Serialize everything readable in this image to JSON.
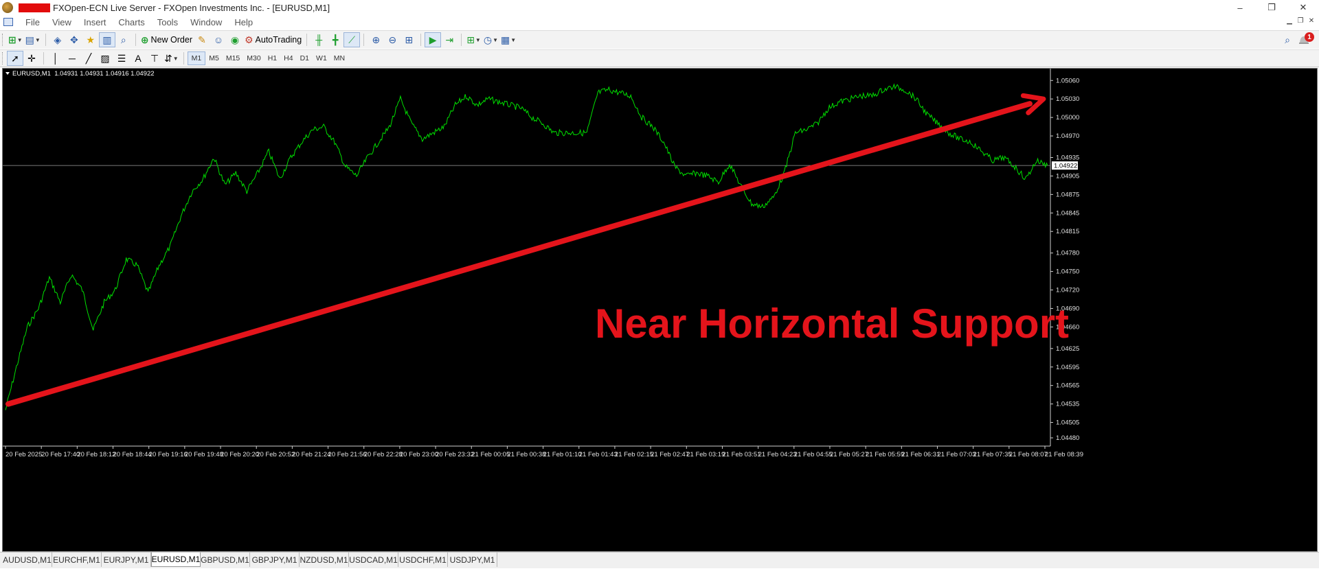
{
  "window": {
    "title": "FXOpen-ECN Live Server - FXOpen Investments Inc. - [EURUSD,M1]",
    "controls": [
      "–",
      "❐",
      "✕"
    ]
  },
  "menu": [
    "File",
    "View",
    "Insert",
    "Charts",
    "Tools",
    "Window",
    "Help"
  ],
  "toolbar": {
    "new_order_label": "New Order",
    "autotrading_label": "AutoTrading",
    "timeframes": [
      "M1",
      "M5",
      "M15",
      "M30",
      "H1",
      "H4",
      "D1",
      "W1",
      "MN"
    ],
    "active_timeframe": "M1",
    "notification_count": "1"
  },
  "chart": {
    "header": "EURUSD,M1  1.04931 1.04931 1.04916 1.04922",
    "current_price": "1.04922",
    "annotation": "Near Horizontal Support",
    "colors": {
      "background": "#000000",
      "line": "#00e000",
      "annotation": "#e4141b",
      "price_line": "#a0a0a0"
    }
  },
  "chart_data": {
    "type": "line",
    "symbol": "EURUSD",
    "timeframe": "M1",
    "ylim": [
      1.0448,
      1.05077
    ],
    "y_ticks": [
      "1.05060",
      "1.05030",
      "1.05000",
      "1.04970",
      "1.04935",
      "1.04905",
      "1.04875",
      "1.04845",
      "1.04815",
      "1.04780",
      "1.04750",
      "1.04720",
      "1.04690",
      "1.04660",
      "1.04625",
      "1.04595",
      "1.04565",
      "1.04535",
      "1.04505",
      "1.04480"
    ],
    "x_ticks": [
      "20 Feb 2025",
      "20 Feb 17:40",
      "20 Feb 18:12",
      "20 Feb 18:44",
      "20 Feb 19:16",
      "20 Feb 19:48",
      "20 Feb 20:20",
      "20 Feb 20:52",
      "20 Feb 21:24",
      "20 Feb 21:56",
      "20 Feb 22:28",
      "20 Feb 23:00",
      "20 Feb 23:32",
      "21 Feb 00:05",
      "21 Feb 00:38",
      "21 Feb 01:10",
      "21 Feb 01:43",
      "21 Feb 02:15",
      "21 Feb 02:47",
      "21 Feb 03:19",
      "21 Feb 03:51",
      "21 Feb 04:23",
      "21 Feb 04:55",
      "21 Feb 05:27",
      "21 Feb 05:59",
      "21 Feb 06:31",
      "21 Feb 07:03",
      "21 Feb 07:35",
      "21 Feb 08:07",
      "21 Feb 08:39"
    ],
    "series": [
      {
        "values": [
          1.04525,
          1.04595,
          1.0466,
          1.0469,
          1.0474,
          1.047,
          1.04745,
          1.0472,
          1.04655,
          1.047,
          1.0472,
          1.0477,
          1.0476,
          1.04715,
          1.0476,
          1.0479,
          1.0484,
          1.0488,
          1.049,
          1.04935,
          1.0489,
          1.0491,
          1.0488,
          1.0491,
          1.04945,
          1.049,
          1.04935,
          1.0496,
          1.0498,
          1.04985,
          1.0496,
          1.0492,
          1.04905,
          1.04935,
          1.0496,
          1.04985,
          1.0503,
          1.0499,
          1.04965,
          1.04975,
          1.04985,
          1.0502,
          1.05035,
          1.0502,
          1.0503,
          1.05025,
          1.0502,
          1.05015,
          1.05,
          1.0499,
          1.04975,
          1.04975,
          1.04975,
          1.04975,
          1.0504,
          1.05045,
          1.0504,
          1.05035,
          1.05,
          1.04985,
          1.0496,
          1.0492,
          1.04905,
          1.0491,
          1.04905,
          1.04895,
          1.04925,
          1.0489,
          1.0486,
          1.04855,
          1.0487,
          1.0491,
          1.04975,
          1.0498,
          1.0499,
          1.05015,
          1.05025,
          1.0503,
          1.05035,
          1.05035,
          1.05045,
          1.0505,
          1.05045,
          1.0503,
          1.05005,
          1.0499,
          1.04975,
          1.04965,
          1.0496,
          1.04945,
          1.0493,
          1.04935,
          1.0492,
          1.049,
          1.0493,
          1.04922
        ]
      }
    ],
    "annotation_arrow": {
      "from": [
        "20 Feb 2025",
        1.04535
      ],
      "to": [
        "21 Feb 08:39",
        1.0503
      ]
    },
    "current_price": 1.04922,
    "grid": false
  },
  "tabs": [
    "AUDUSD,M1",
    "EURCHF,M1",
    "EURJPY,M1",
    "EURUSD,M1",
    "GBPUSD,M1",
    "GBPJPY,M1",
    "NZDUSD,M1",
    "USDCAD,M1",
    "USDCHF,M1",
    "USDJPY,M1"
  ],
  "active_tab": "EURUSD,M1",
  "icons": [
    "app-icon",
    "new-chart-icon",
    "profiles-icon",
    "market-watch-icon",
    "navigator-icon",
    "favorites-icon",
    "terminal-icon",
    "tester-icon",
    "new-order-icon",
    "metaeditor-icon",
    "signals-icon",
    "market-icon",
    "autotrading-icon",
    "bar-chart-icon",
    "candles-icon",
    "line-chart-icon",
    "zoom-in-icon",
    "zoom-out-icon",
    "tile-icon",
    "autoscroll-icon",
    "chart-shift-icon",
    "indicators-icon",
    "periods-icon",
    "templates-icon",
    "cursor-icon",
    "crosshair-icon",
    "vline-icon",
    "hline-icon",
    "trendline-icon",
    "channel-icon",
    "fibo-icon",
    "text-icon",
    "label-icon",
    "arrows-icon",
    "search-icon",
    "notification-icon"
  ]
}
